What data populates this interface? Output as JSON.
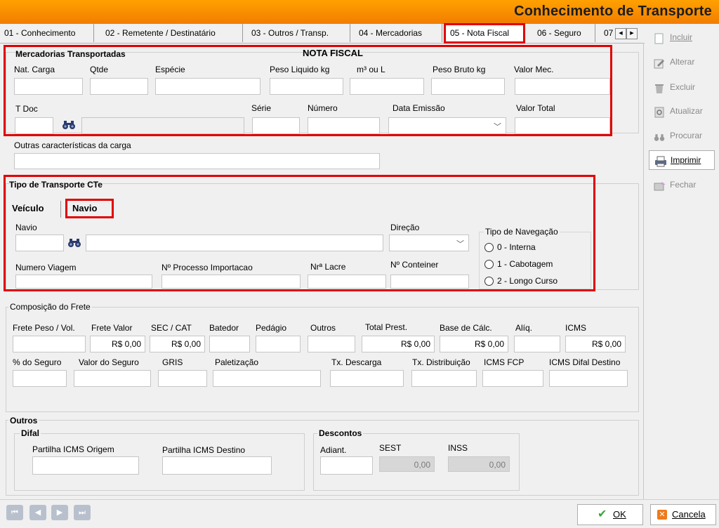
{
  "window": {
    "title": "Conhecimento de Transporte"
  },
  "tabs": [
    "01 - Conhecimento",
    "02 - Remetente / Destinatário",
    "03 - Outros / Transp.",
    "04 - Mercadorias",
    "05 - Nota Fiscal",
    "06 - Seguro",
    "07"
  ],
  "active_tab": "05 - Nota Fiscal",
  "merc": {
    "title": "Mercadorias Transportadas",
    "nf_title": "NOTA FISCAL",
    "nat_carga": "Nat. Carga",
    "qtde": "Qtde",
    "especie": "Espécie",
    "peso_liquido": "Peso Liquido kg",
    "m3": "m³ ou L",
    "peso_bruto": "Peso Bruto kg",
    "valor_mec": "Valor Mec.",
    "t_doc": "T Doc",
    "serie": "Série",
    "numero": "Número",
    "data_emissao": "Data Emissão",
    "valor_total": "Valor Total"
  },
  "outras": {
    "label": "Outras características da carga"
  },
  "tipo": {
    "title": "Tipo de Transporte CTe",
    "tab_veiculo": "Veículo",
    "tab_navio": "Navio",
    "navio": "Navio",
    "direcao": "Direção",
    "tipo_nav": "Tipo de Navegação",
    "radio": [
      "0 - Interna",
      "1 - Cabotagem",
      "2 - Longo Curso"
    ],
    "num_viagem": "Numero Viagem",
    "num_processo": "Nº Processo Importacao",
    "nr_lacre": "Nrª Lacre",
    "num_conteiner": "Nº Conteiner"
  },
  "frete": {
    "title": "Composição do Frete",
    "frete_peso": "Frete Peso / Vol.",
    "frete_valor": "Frete Valor",
    "sec_cat": "SEC / CAT",
    "batedor": "Batedor",
    "pedagio": "Pedágio",
    "outros": "Outros",
    "total_prest": "Total Prest.",
    "base_calc": "Base de Cálc.",
    "aliq": "Alíq.",
    "icms": "ICMS",
    "v_frete_valor": "R$ 0,00",
    "v_sec_cat": "R$ 0,00",
    "v_total_prest": "R$ 0,00",
    "v_base_calc": "R$ 0,00",
    "v_icms": "R$ 0,00",
    "perc_seguro": "% do Seguro",
    "valor_seguro": "Valor do Seguro",
    "gris": "GRIS",
    "paletizacao": "Paletização",
    "tx_descarga": "Tx. Descarga",
    "tx_distribuicao": "Tx. Distribuição",
    "icms_fcp": "ICMS FCP",
    "icms_difal": "ICMS Difal Destino"
  },
  "outros": {
    "title": "Outros",
    "difal": "Difal",
    "partilha_origem": "Partilha ICMS Origem",
    "partilha_destino": "Partilha ICMS Destino",
    "descontos": "Descontos",
    "adiant": "Adiant.",
    "sest": "SEST",
    "inss": "INSS",
    "v_sest": "0,00",
    "v_inss": "0,00"
  },
  "side": {
    "incluir": "Incluir",
    "alterar": "Alterar",
    "excluir": "Excluir",
    "atualizar": "Atualizar",
    "procurar": "Procurar",
    "imprimir": "Imprimir",
    "fechar": "Fechar"
  },
  "footer": {
    "ok": "OK",
    "cancela": "Cancela"
  },
  "colors": {
    "titlebar": "#f6a000",
    "highlight": "#e00000"
  }
}
